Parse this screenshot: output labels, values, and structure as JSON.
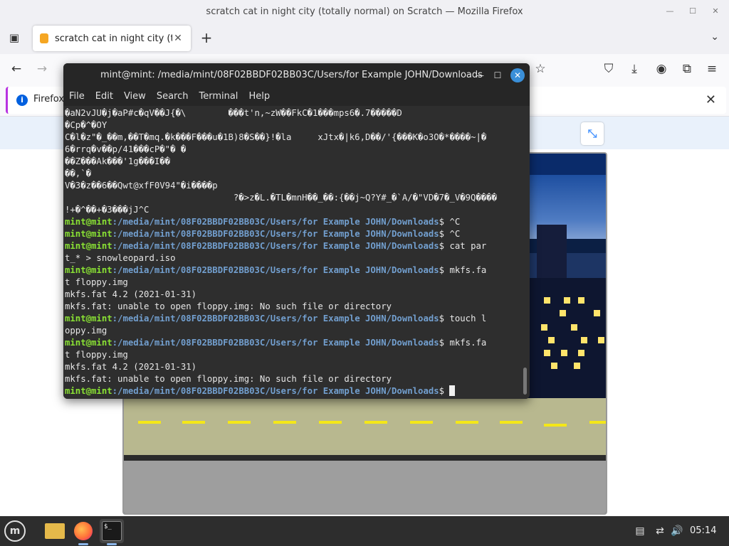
{
  "firefox": {
    "window_title": "scratch cat in night city (totally normal) on Scratch — Mozilla Firefox",
    "tab_title": "scratch cat in night city (totally normal) on Scratch",
    "notification_text": "Firefox"
  },
  "terminal": {
    "window_title": "mint@mint: /media/mint/08F02BBDF02BB03C/Users/for Example JOHN/Downloads",
    "menu": [
      "File",
      "Edit",
      "View",
      "Search",
      "Terminal",
      "Help"
    ],
    "user_host": "mint@mint",
    "path": ":/media/mint/08F02BBDF02BB03C/Users/for Example JOHN/Downloads",
    "prompt_symbol": "$ ",
    "garbage_lines": [
      "�aN2vJU�j�aP#c�qV��J{�\\        ���t'n,~zW��FkC�1���mps6�.7�����D",
      "�Cp�^�OY",
      "C�l�z\"�_��m,��T�mq.�k���F���u�1B)8�S��}!�la     xJtx�|k6,D��/'{���K�o3O�*����~|�",
      "6�rrq�v��p/41���cP�\"� �",
      "��Z���Ak���'1g���I��",
      "��,`�",
      "V�3�z��6��Qwt@xfF0V94\"�i����p",
      "                                ?�>z�L.�TL�mnH��_��:{��j~Q?Y#_�`A/�\"VD�7�_V�9Q����",
      "!+�^��+�3���jJ^C"
    ],
    "cmd1": "^C",
    "cmd2": "^C",
    "cmd3_a": "cat par",
    "cmd3_b": "t_* > snowleopard.iso",
    "cmd4_a": "mkfs.fa",
    "cmd4_b": "t floppy.img",
    "out1": "mkfs.fat 4.2 (2021-01-31)",
    "out2": "mkfs.fat: unable to open floppy.img: No such file or directory",
    "cmd5_a": "touch l",
    "cmd5_b": "oppy.img",
    "cmd6_a": "mkfs.fa",
    "cmd6_b": "t floppy.img",
    "out3": "mkfs.fat 4.2 (2021-01-31)",
    "out4": "mkfs.fat: unable to open floppy.img: No such file or directory"
  },
  "taskbar": {
    "clock": "05:14"
  },
  "colors": {
    "prompt_user": "#8ae234",
    "prompt_path": "#729fcf",
    "terminal_bg": "#2e2e2e"
  }
}
